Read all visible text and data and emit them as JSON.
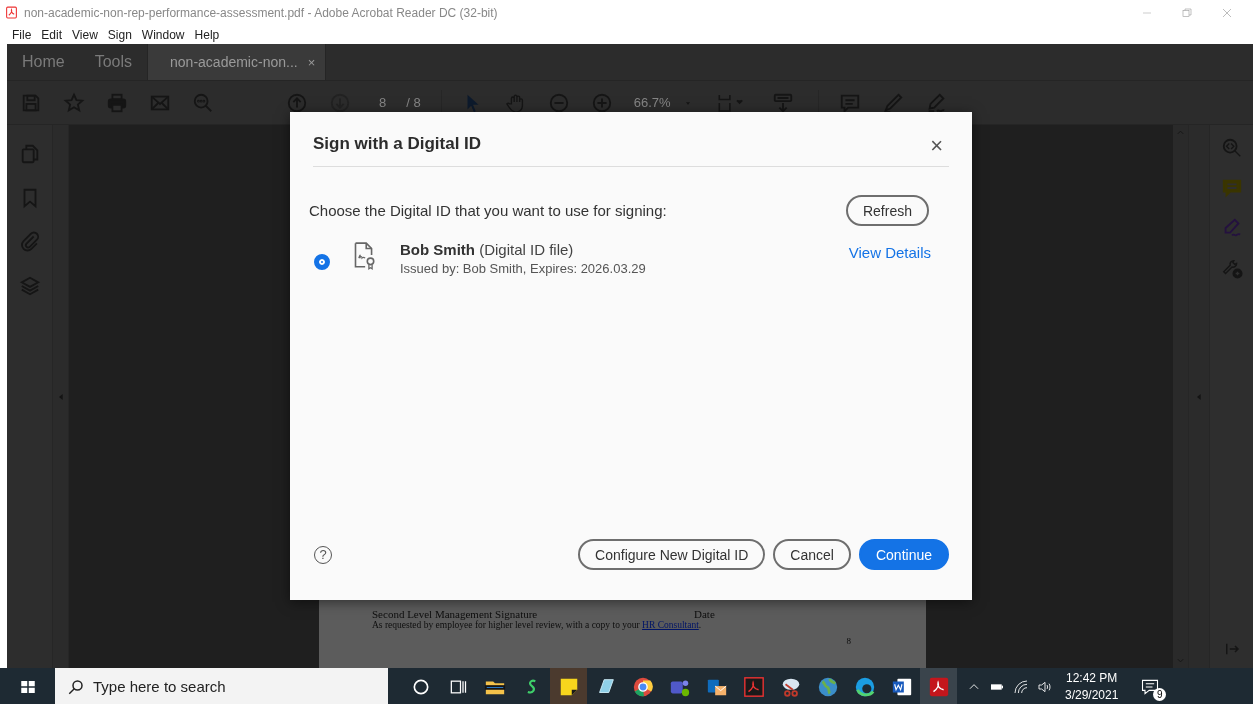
{
  "window": {
    "title": "non-academic-non-rep-performance-assessment.pdf - Adobe Acrobat Reader DC (32-bit)"
  },
  "menu": [
    "File",
    "Edit",
    "View",
    "Sign",
    "Window",
    "Help"
  ],
  "tabs": [
    {
      "label": "Home",
      "selected": false,
      "kind": "nav"
    },
    {
      "label": "Tools",
      "selected": false,
      "kind": "nav"
    },
    {
      "label": "non-academic-non...",
      "selected": true,
      "kind": "document",
      "close": "×"
    }
  ],
  "toolbar": {
    "page": "8",
    "page_total": "/ 8",
    "zoom": "66.7%"
  },
  "document": {
    "signature_label": "Second Level Management Signature",
    "date_label": "Date",
    "note": "As requested by employee for higher level review, with a copy to your ",
    "note_link": "HR Consultant",
    "note_end": ".",
    "page_number": "8"
  },
  "dialog": {
    "title": "Sign with a Digital ID",
    "close": "×",
    "prompt": "Choose the Digital ID that you want to use for signing:",
    "refresh": "Refresh",
    "ids": [
      {
        "name": "Bob Smith",
        "type": "(Digital ID file)",
        "issued": "Issued by: Bob Smith, Expires: 2026.03.29",
        "details": "View Details",
        "selected": true
      }
    ],
    "help": "?",
    "buttons": [
      {
        "label": "Configure New Digital ID",
        "kind": "secondary"
      },
      {
        "label": "Cancel",
        "kind": "secondary"
      },
      {
        "label": "Continue",
        "kind": "primary"
      }
    ]
  },
  "taskbar": {
    "search_placeholder": "Type here to search",
    "time": "12:42 PM",
    "date": "3/29/2021",
    "notifications": "9"
  }
}
